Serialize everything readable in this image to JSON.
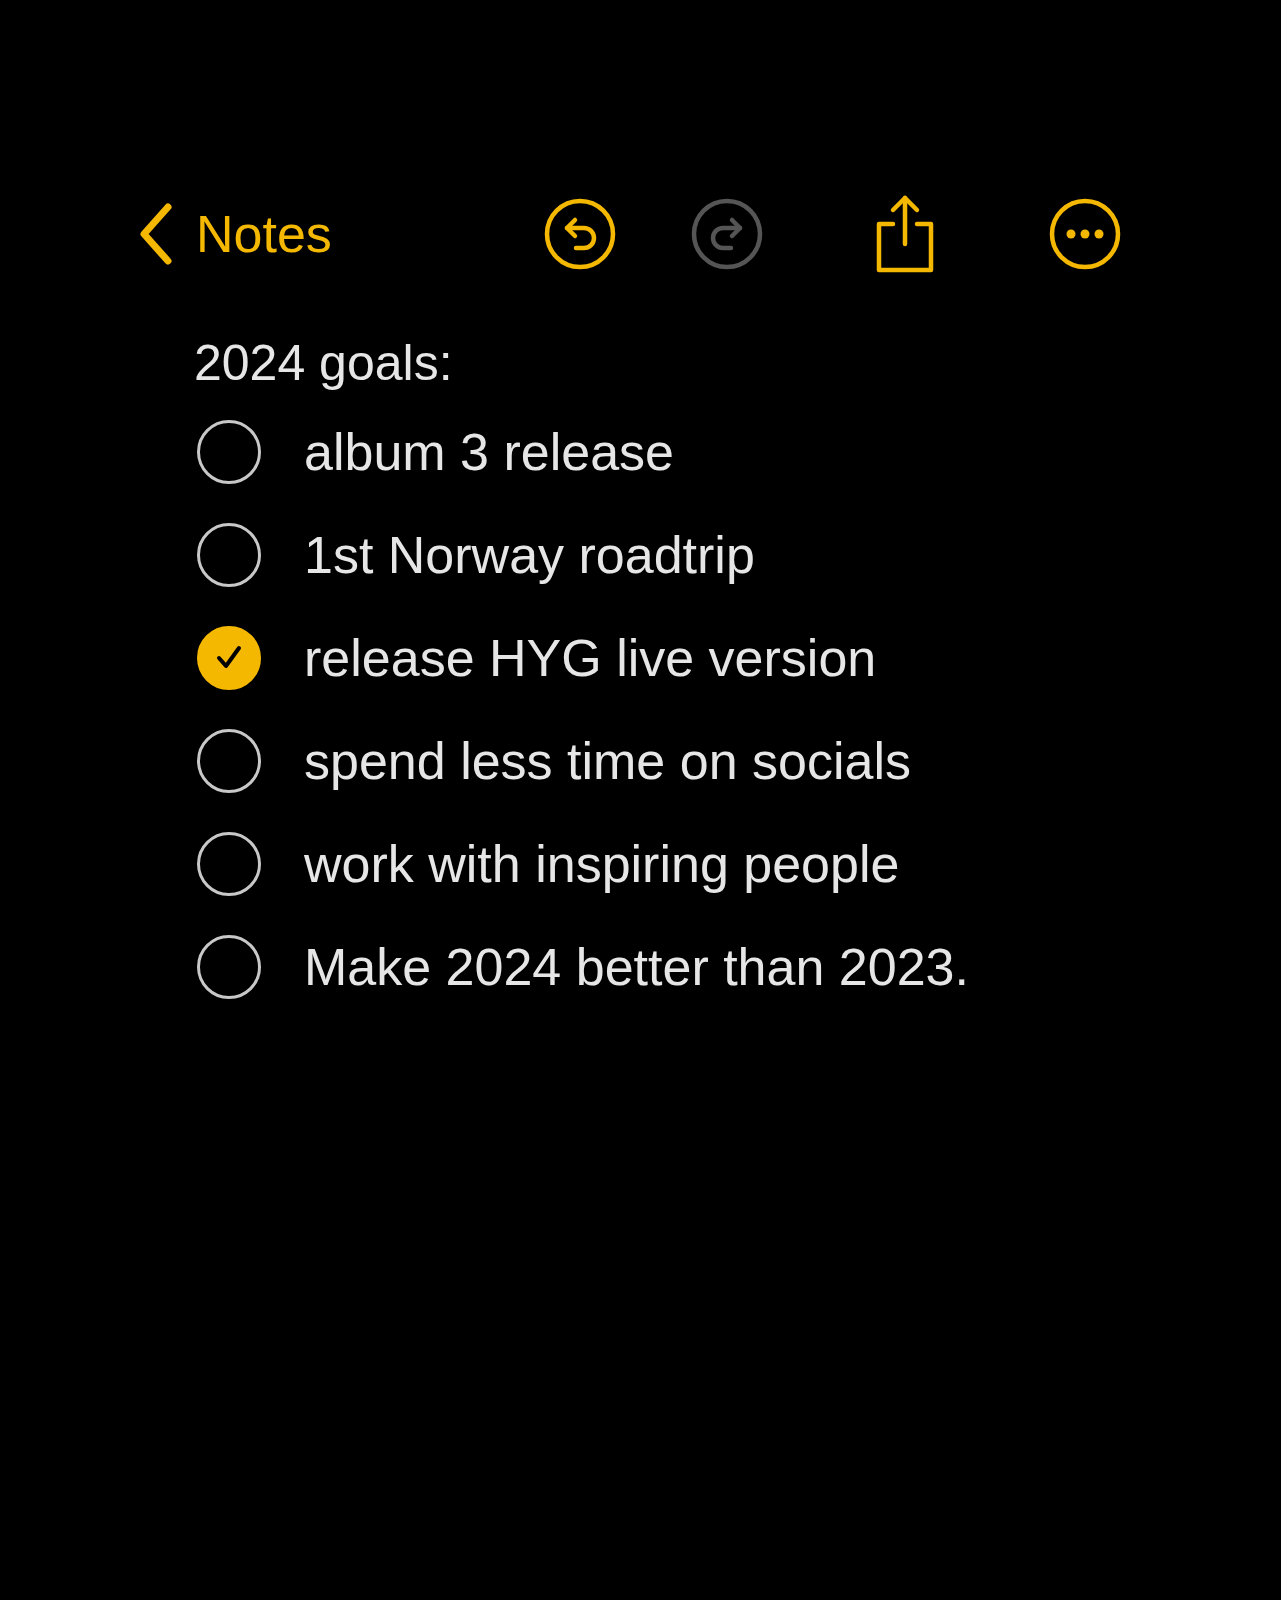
{
  "nav": {
    "back_label": "Notes",
    "undo": {
      "disabled": false
    },
    "redo": {
      "disabled": true
    }
  },
  "note": {
    "title": "2024 goals:",
    "items": [
      {
        "text": "album 3 release",
        "checked": false
      },
      {
        "text": "1st Norway roadtrip",
        "checked": false
      },
      {
        "text": "release HYG live version",
        "checked": true
      },
      {
        "text": "spend less time on socials",
        "checked": false
      },
      {
        "text": "work with inspiring people",
        "checked": false
      },
      {
        "text": "Make 2024 better than 2023.",
        "checked": false
      }
    ]
  }
}
